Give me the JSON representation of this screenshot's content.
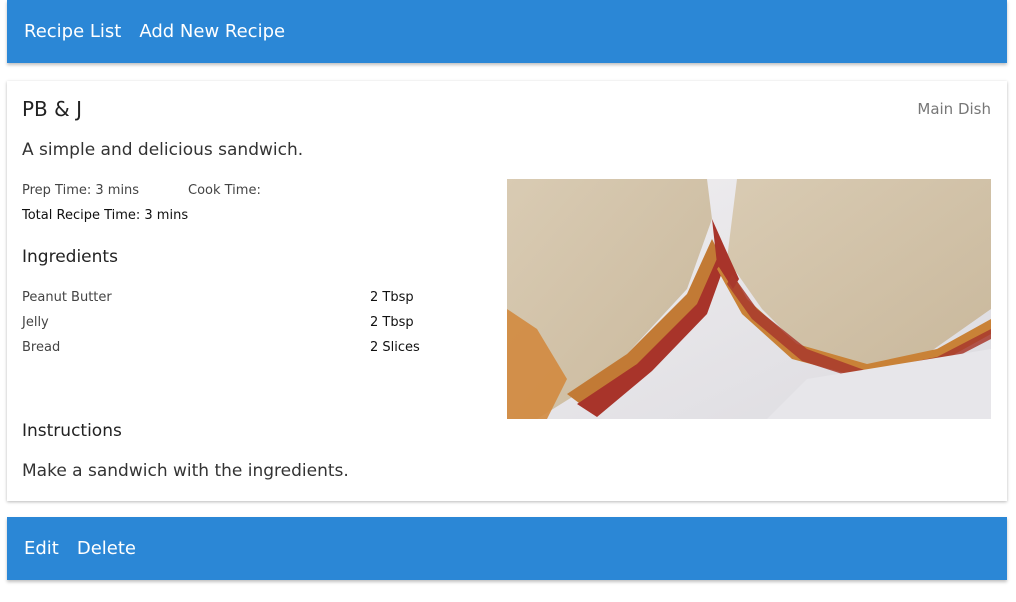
{
  "nav": {
    "recipe_list": "Recipe List",
    "add_new_recipe": "Add New Recipe"
  },
  "recipe": {
    "title": "PB & J",
    "category": "Main Dish",
    "description": "A simple and delicious sandwich.",
    "prep_time": "Prep Time: 3 mins",
    "cook_time": "Cook Time:",
    "total_time": "Total Recipe Time: 3 mins",
    "ingredients_heading": "Ingredients",
    "ingredients": [
      {
        "name": "Peanut Butter",
        "qty": "2 Tbsp"
      },
      {
        "name": "Jelly",
        "qty": "2 Tbsp"
      },
      {
        "name": "Bread",
        "qty": "2 Slices"
      }
    ],
    "instructions_heading": "Instructions",
    "instructions": "Make a sandwich with the ingredients."
  },
  "actions": {
    "edit": "Edit",
    "delete": "Delete"
  },
  "colors": {
    "bar": "#2b87d6"
  }
}
